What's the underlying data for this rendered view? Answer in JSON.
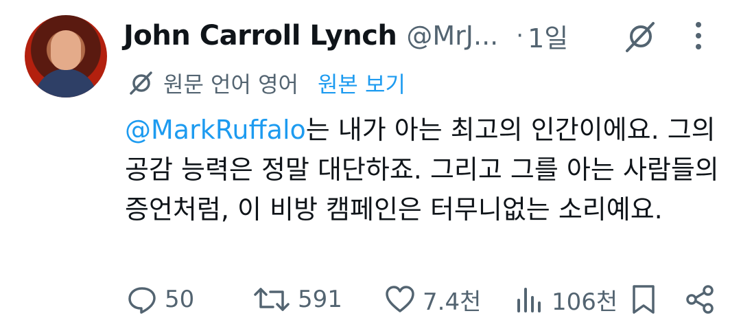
{
  "author": {
    "display_name": "John Carroll Lynch",
    "handle": "@MrJ...",
    "separator": "·",
    "time": "1일"
  },
  "translation": {
    "label": "원문 언어 영어",
    "link": "원본 보기"
  },
  "tweet": {
    "mention": "@MarkRuffalo",
    "text": "는 내가 아는 최고의 인간이에요. 그의 공감 능력은 정말 대단하죠. 그리고 그를 아는 사람들의 증언처럼, 이 비방 캠페인은 터무니없는 소리예요."
  },
  "actions": {
    "replies": "50",
    "retweets": "591",
    "likes": "7.4천",
    "views": "106천"
  },
  "icons": {
    "header": [
      "globe-slash-icon",
      "more-vertical-icon"
    ],
    "translate": "globe-slash-icon",
    "actions": [
      "reply-icon",
      "retweet-icon",
      "like-icon",
      "views-icon",
      "bookmark-icon",
      "share-icon"
    ]
  },
  "colors": {
    "text": "#0f1419",
    "muted": "#536471",
    "link": "#1d9bf0",
    "background": "#ffffff"
  }
}
